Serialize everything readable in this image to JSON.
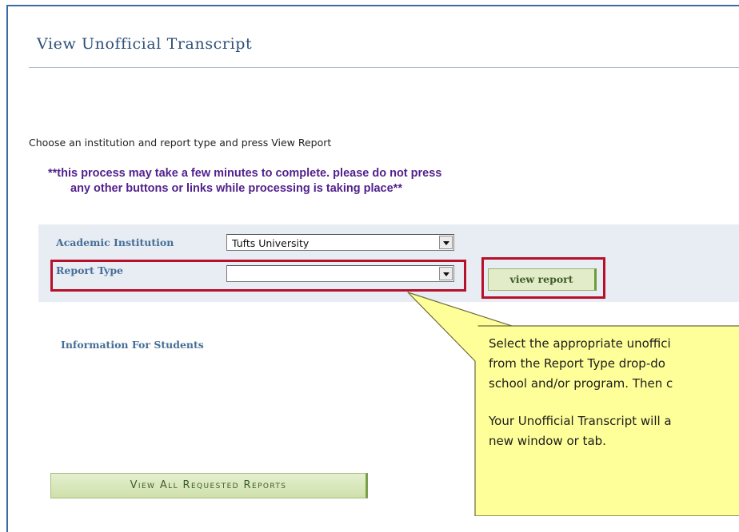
{
  "page": {
    "title": "View Unofficial Transcript",
    "instructions": "Choose an institution and report type and press View Report",
    "warning_line1": "**this process may take a few minutes to complete. please do not press",
    "warning_line2": "any other buttons or links while processing is taking place**"
  },
  "form": {
    "institution_label": "Academic Institution",
    "institution_value": "Tufts University",
    "report_type_label": "Report Type",
    "report_type_value": "",
    "view_report_label": "view report"
  },
  "links": {
    "info_for_students": "Information For Students",
    "view_all_requested": "View All Requested Reports"
  },
  "callout": {
    "line1": "Select the appropriate unoffici",
    "line2": "from the Report Type drop-do",
    "line3": "school and/or program. Then c",
    "line4": "Your Unofficial Transcript will a",
    "line5": "new window or tab."
  },
  "colors": {
    "highlight_border": "#b6102a",
    "callout_fill": "#ffff99",
    "panel_bg": "#e8ecf3",
    "title_color": "#2d4f79"
  }
}
